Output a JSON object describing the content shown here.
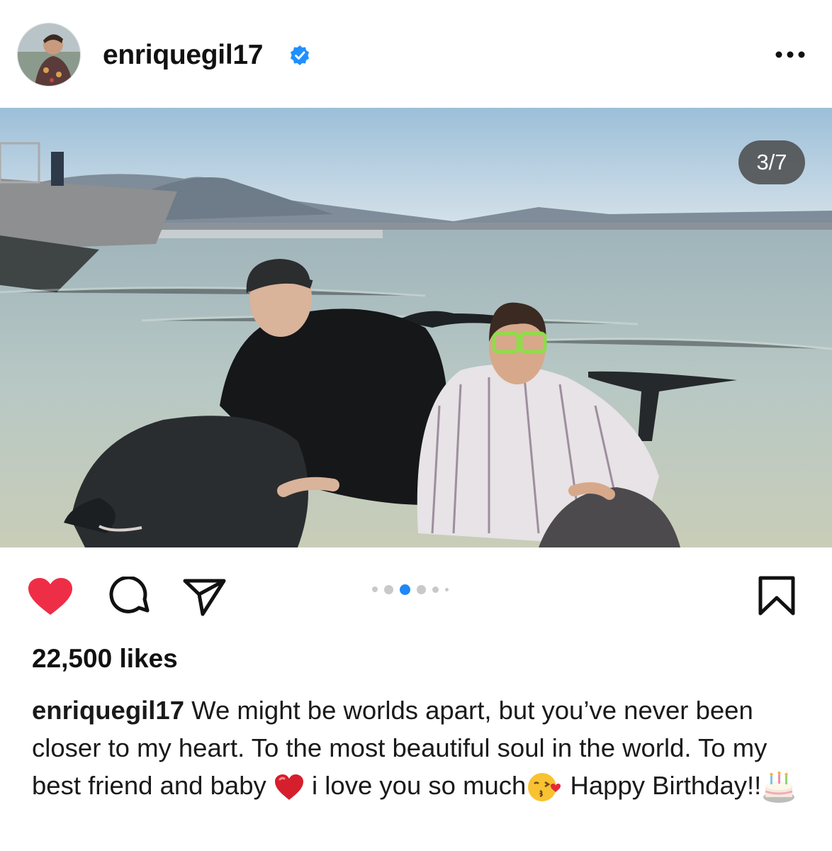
{
  "post": {
    "username": "enriquegil17",
    "image_counter": "3/7",
    "carousel": {
      "count": 6,
      "active_index": 2
    },
    "likes": "22,500 likes",
    "liked": true,
    "caption": {
      "username": "enriquegil17",
      "text_1": " We might be worlds apart, but you’ve never been closer to my heart. To the most beautiful soul in the world. To my best friend and baby ",
      "text_2": " i love you so much",
      "text_3": " Happy Birthday!!"
    }
  },
  "icons": [
    "verified-badge-icon",
    "more-options-icon",
    "heart-icon",
    "comment-icon",
    "share-icon",
    "bookmark-icon",
    "red-heart-emoji",
    "kiss-face-emoji",
    "birthday-cake-emoji"
  ],
  "colors": {
    "heart": "#ee2e46",
    "verified": "#1e90ff",
    "active_dot": "#1e88f5"
  }
}
